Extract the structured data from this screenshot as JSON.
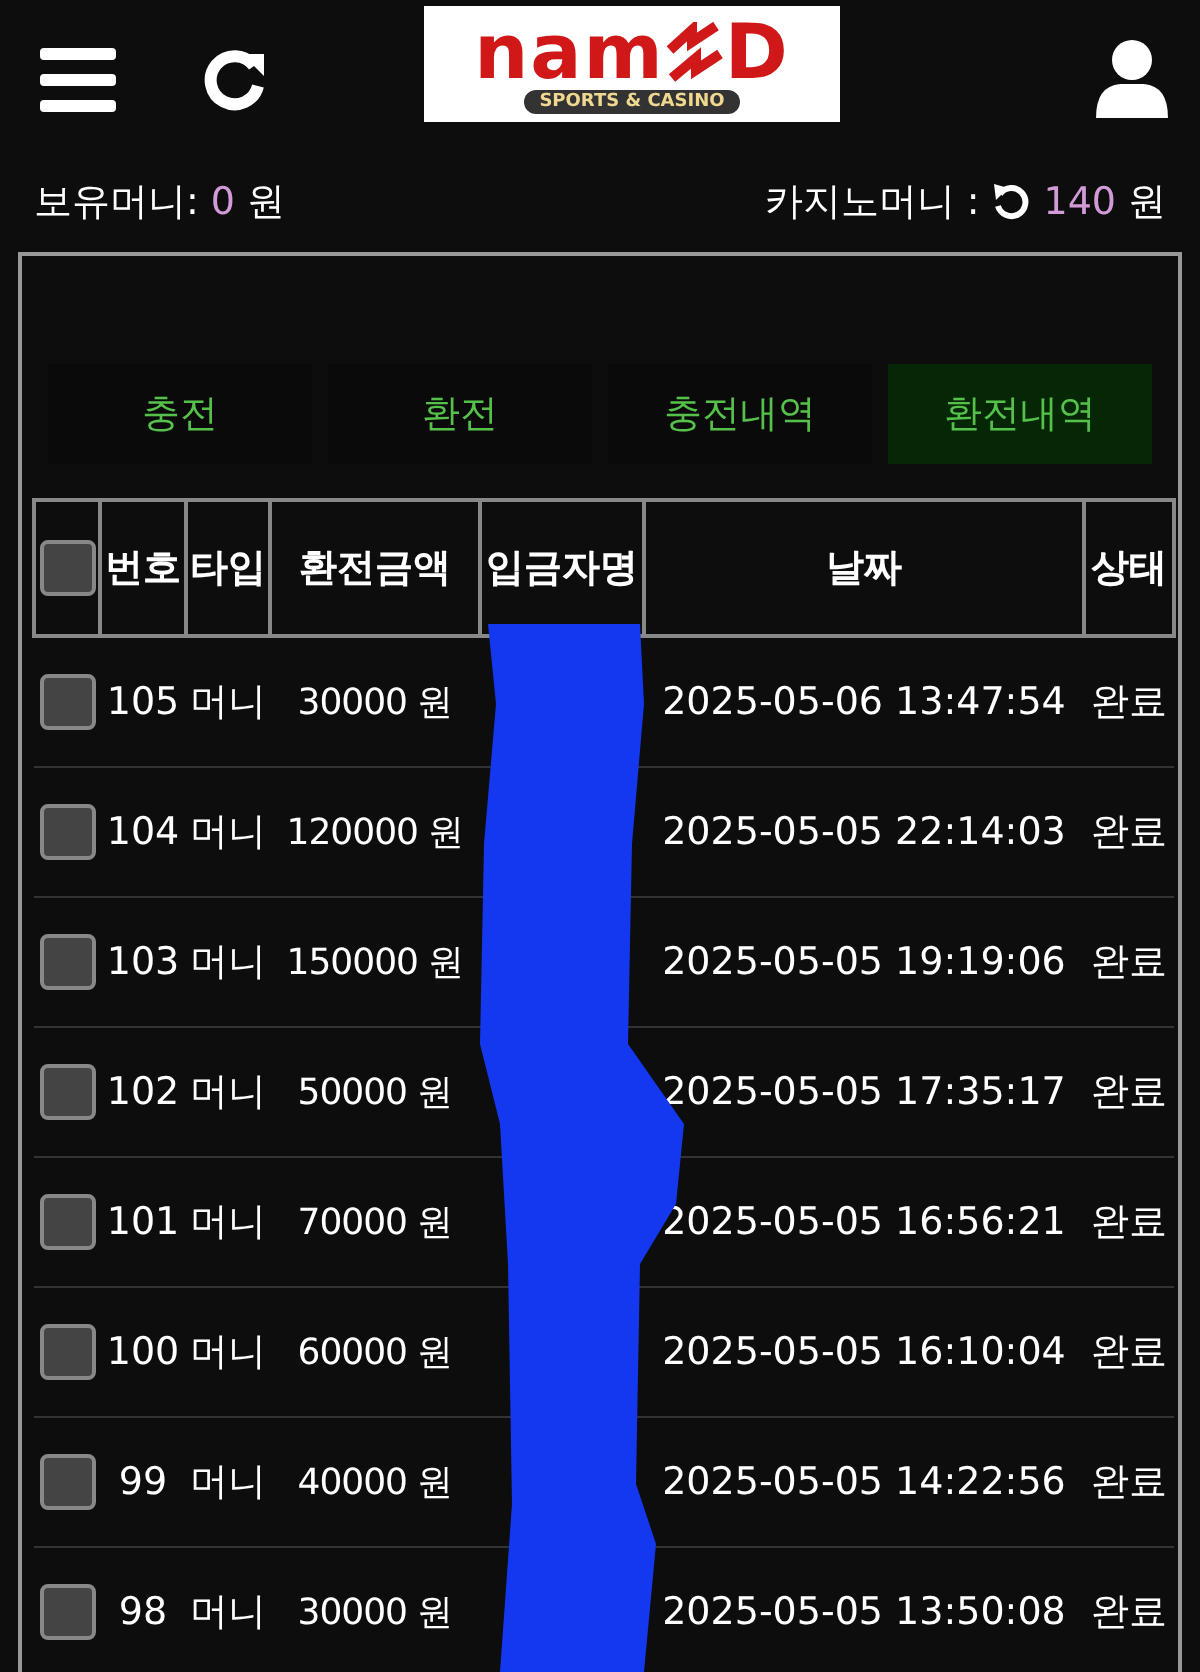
{
  "header": {
    "logo": {
      "wordmark": "nam",
      "wordmark_end": "D",
      "tagline": "SPORTS & CASINO"
    }
  },
  "balances": {
    "money_label": "보유머니:",
    "money_value": "0",
    "money_unit": "원",
    "casino_label": "카지노머니 :",
    "casino_value": "140",
    "casino_unit": "원"
  },
  "tabs": [
    {
      "label": "충전",
      "selected": false
    },
    {
      "label": "환전",
      "selected": false
    },
    {
      "label": "충전내역",
      "selected": false
    },
    {
      "label": "환전내역",
      "selected": true
    }
  ],
  "table": {
    "select_all_checked": false,
    "columns": [
      "번호",
      "타입",
      "환전금액",
      "입금자명",
      "날짜",
      "상태"
    ],
    "rows": [
      {
        "checked": false,
        "no": "105",
        "type": "머니",
        "amount": "30000 원",
        "date": "2025-05-06 13:47:54",
        "status": "완료"
      },
      {
        "checked": false,
        "no": "104",
        "type": "머니",
        "amount": "120000 원",
        "date": "2025-05-05 22:14:03",
        "status": "완료"
      },
      {
        "checked": false,
        "no": "103",
        "type": "머니",
        "amount": "150000 원",
        "date": "2025-05-05 19:19:06",
        "status": "완료"
      },
      {
        "checked": false,
        "no": "102",
        "type": "머니",
        "amount": "50000 원",
        "date": "2025-05-05 17:35:17",
        "status": "완료"
      },
      {
        "checked": false,
        "no": "101",
        "type": "머니",
        "amount": "70000 원",
        "date": "2025-05-05 16:56:21",
        "status": "완료"
      },
      {
        "checked": false,
        "no": "100",
        "type": "머니",
        "amount": "60000 원",
        "date": "2025-05-05 16:10:04",
        "status": "완료"
      },
      {
        "checked": false,
        "no": "99",
        "type": "머니",
        "amount": "40000 원",
        "date": "2025-05-05 14:22:56",
        "status": "완료"
      },
      {
        "checked": false,
        "no": "98",
        "type": "머니",
        "amount": "30000 원",
        "date": "2025-05-05 13:50:08",
        "status": "완료"
      }
    ]
  }
}
